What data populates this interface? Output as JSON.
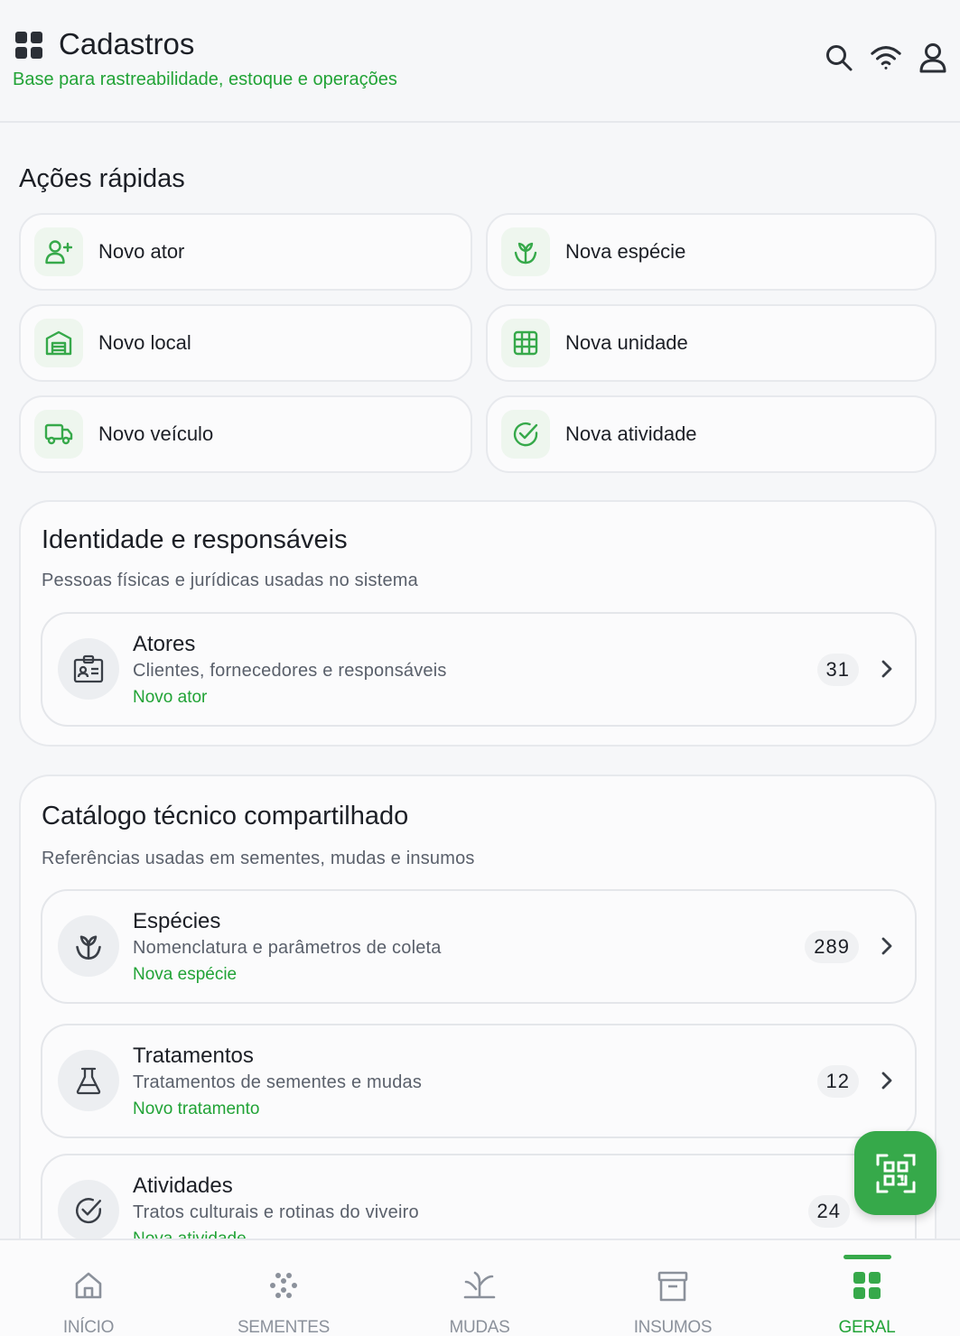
{
  "header": {
    "title": "Cadastros",
    "subtitle": "Base para rastreabilidade, estoque e operações",
    "icons": [
      "grid-icon",
      "search-icon",
      "wifi-icon",
      "user-icon"
    ]
  },
  "quick_actions": {
    "title": "Ações rápidas",
    "items": [
      {
        "label": "Novo ator",
        "icon": "user-plus-icon"
      },
      {
        "label": "Nova espécie",
        "icon": "sprout-icon"
      },
      {
        "label": "Novo local",
        "icon": "warehouse-icon"
      },
      {
        "label": "Nova unidade",
        "icon": "grid-table-icon"
      },
      {
        "label": "Novo veículo",
        "icon": "truck-icon"
      },
      {
        "label": "Nova atividade",
        "icon": "check-circle-icon"
      }
    ]
  },
  "identity_section": {
    "title": "Identidade e responsáveis",
    "subtitle": "Pessoas físicas e jurídicas usadas no sistema",
    "rows": [
      {
        "title": "Atores",
        "description": "Clientes, fornecedores e responsáveis",
        "action": "Novo ator",
        "count": "31",
        "icon": "id-card-icon"
      }
    ]
  },
  "catalog_section": {
    "title": "Catálogo técnico compartilhado",
    "subtitle": "Referências usadas em sementes, mudas e insumos",
    "rows": [
      {
        "title": "Espécies",
        "description": "Nomenclatura e parâmetros de coleta",
        "action": "Nova espécie",
        "count": "289",
        "icon": "sprout-icon"
      },
      {
        "title": "Tratamentos",
        "description": "Tratamentos de sementes e mudas",
        "action": "Novo tratamento",
        "count": "12",
        "icon": "flask-icon"
      },
      {
        "title": "Atividades",
        "description": "Tratos culturais e rotinas do viveiro",
        "action": "Nova atividade",
        "count": "24",
        "icon": "check-circle-icon"
      }
    ]
  },
  "fab": {
    "icon": "qr-code-icon"
  },
  "bottom_nav": {
    "active": "GERAL",
    "items": [
      {
        "label": "INÍCIO",
        "icon": "home-icon"
      },
      {
        "label": "SEMENTES",
        "icon": "seeds-icon"
      },
      {
        "label": "MUDAS",
        "icon": "seedling-icon"
      },
      {
        "label": "INSUMOS",
        "icon": "archive-icon"
      },
      {
        "label": "GERAL",
        "icon": "grid-icon"
      }
    ]
  },
  "colors": {
    "accent": "#36a94a",
    "accent_text": "#21a336",
    "text": "#1c1f26",
    "muted": "#5a606b"
  }
}
